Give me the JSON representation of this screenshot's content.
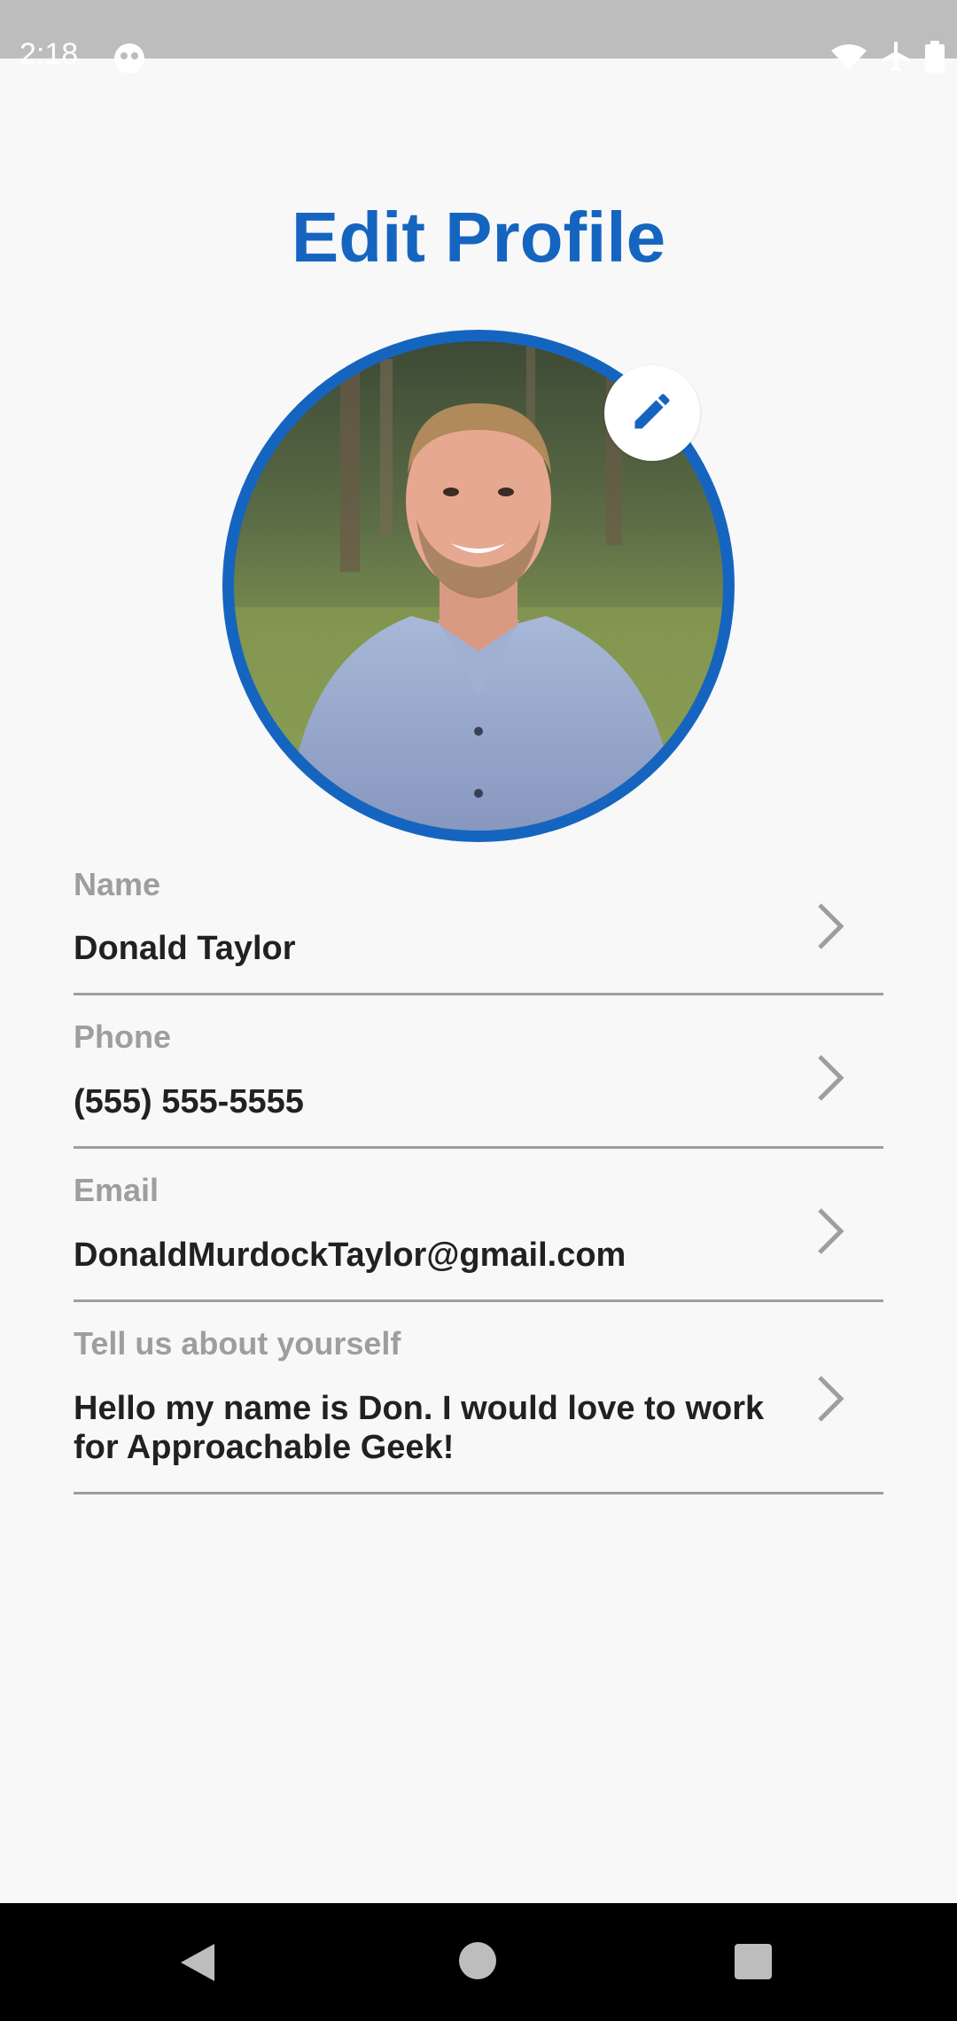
{
  "status_bar": {
    "time": "2:18",
    "icons": [
      "app-notification-icon",
      "wifi-icon",
      "airplane-mode-icon",
      "battery-icon"
    ]
  },
  "page": {
    "title": "Edit Profile"
  },
  "avatar": {
    "edit_icon": "pencil-icon",
    "ring_color": "#1565c0"
  },
  "fields": [
    {
      "label": "Name",
      "value": "Donald Taylor"
    },
    {
      "label": "Phone",
      "value": "(555) 555-5555"
    },
    {
      "label": "Email",
      "value": "DonaldMurdockTaylor@gmail.com"
    },
    {
      "label": "Tell us about yourself",
      "value": "Hello my name is Don. I would love to work for Approachable Geek!"
    }
  ],
  "nav_bar": {
    "icons": [
      "back-icon",
      "home-icon",
      "recents-icon"
    ]
  },
  "colors": {
    "accent": "#1565c0",
    "label": "#9e9e9e",
    "text": "#212121",
    "background": "#f8f8f8"
  }
}
